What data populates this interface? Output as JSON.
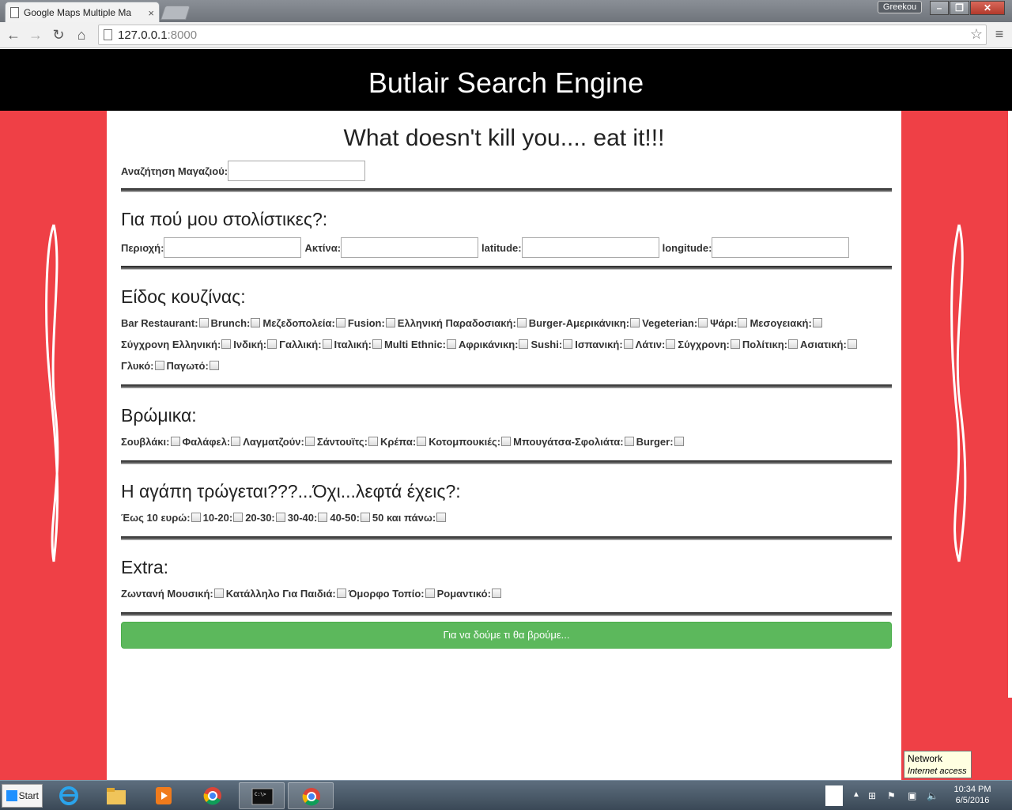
{
  "browser": {
    "tab_title": "Google Maps Multiple Ma",
    "tab_close": "×",
    "profile_name": "Greekou",
    "url_host": "127.0.0.1",
    "url_port": ":8000"
  },
  "header": {
    "title": "Butlair Search Engine"
  },
  "main": {
    "tagline": "What doesn't kill you.... eat it!!!",
    "store_search_label": "Αναζήτηση Μαγαζιού:",
    "store_search_value": ""
  },
  "location": {
    "title": "Για πού μου στολίστικες?:",
    "area_label": "Περιοχή:",
    "radius_label": "Ακτίνα:",
    "latitude_label": "latitude:",
    "longitude_label": "longitude:"
  },
  "cuisine": {
    "title": "Είδος κουζίνας:",
    "options": [
      "Bar Restaurant:",
      "Brunch:",
      "Μεζεδοπολεία:",
      "Fusion:",
      "Ελληνική Παραδοσιακή:",
      "Burger-Αμερικάνικη:",
      "Vegeterian:",
      "Ψάρι:",
      "Μεσογειακή:",
      "Σύγχρονη Ελληνική:",
      "Ινδική:",
      "Γαλλική:",
      "Ιταλική:",
      "Multi Ethnic:",
      "Αφρικάνικη:",
      "Sushi:",
      "Ισπανική:",
      "Λάτιν:",
      "Σύγχρονη:",
      "Πολίτικη:",
      "Ασιατική:",
      "Γλυκό:",
      "Παγωτό:"
    ]
  },
  "street_food": {
    "title": "Βρώμικα:",
    "options": [
      "Σουβλάκι:",
      "Φαλάφελ:",
      "Λαγματζούν:",
      "Σάντουϊτς:",
      "Κρέπα:",
      "Κοτομπουκιές:",
      "Μπουγάτσα-Σφολιάτα:",
      "Burger:"
    ]
  },
  "price": {
    "title": "Η αγάπη τρώγεται???...Όχι...λεφτά έχεις?:",
    "options": [
      "Έως 10 ευρώ:",
      "10-20:",
      "20-30:",
      "30-40:",
      "40-50:",
      "50 και πάνω:"
    ]
  },
  "extra": {
    "title": "Extra:",
    "options": [
      "Ζωντανή Μουσική:",
      "Κατάλληλο Για Παιδιά:",
      "Όμορφο Τοπίο:",
      "Ρομαντικό:"
    ]
  },
  "submit_label": "Για να δούμε τι θα βρούμε...",
  "taskbar": {
    "start_label": "Start",
    "time": "10:34 PM",
    "date": "6/5/2016"
  },
  "tooltip": {
    "title": "Network",
    "status": "Internet access"
  },
  "colors": {
    "side_red": "#ef4046",
    "banner_black": "#000000",
    "submit_green": "#5cb85c"
  }
}
